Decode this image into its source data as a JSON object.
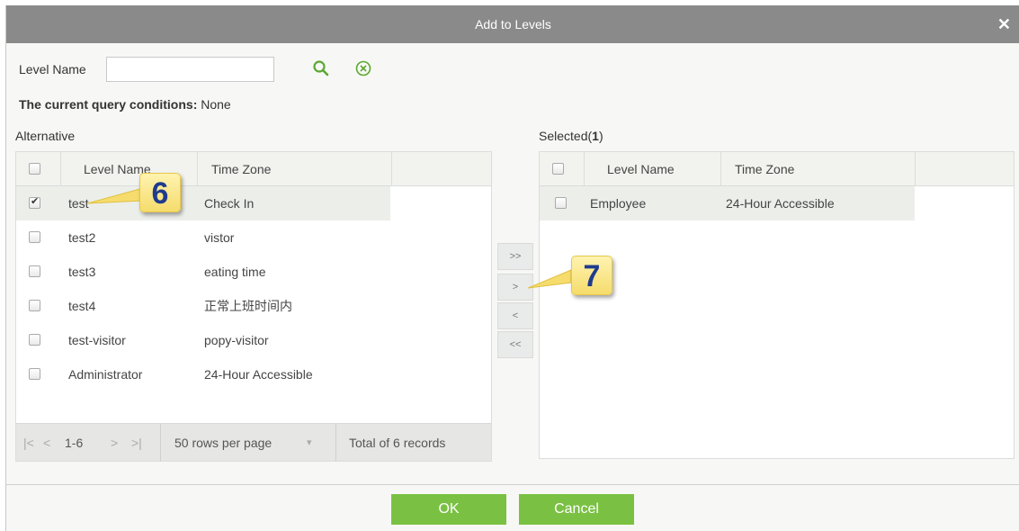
{
  "dialog": {
    "title": "Add to Levels"
  },
  "search": {
    "label": "Level Name",
    "value": "",
    "placeholder": "",
    "conditions_label": "The current query conditions:",
    "conditions_value": "None"
  },
  "alternative": {
    "title": "Alternative",
    "columns": [
      "Level Name",
      "Time Zone"
    ],
    "rows": [
      {
        "name": "test",
        "zone": "Check In",
        "checked": true
      },
      {
        "name": "test2",
        "zone": "vistor",
        "checked": false
      },
      {
        "name": "test3",
        "zone": "eating time",
        "checked": false
      },
      {
        "name": "test4",
        "zone": "正常上班时间内",
        "checked": false
      },
      {
        "name": "test-visitor",
        "zone": "popy-visitor",
        "checked": false
      },
      {
        "name": "Administrator",
        "zone": "24-Hour Accessible",
        "checked": false
      }
    ],
    "pager": {
      "first": "|<",
      "prev": "<",
      "range": "1-6",
      "next": ">",
      "last": ">|",
      "rows_per_page": "50 rows per page",
      "dropdown": "▾",
      "total": "Total of 6 records"
    }
  },
  "selected": {
    "title": "Selected(",
    "count": "1",
    "title_end": ")",
    "columns": [
      "Level Name",
      "Time Zone"
    ],
    "rows": [
      {
        "name": "Employee",
        "zone": "24-Hour Accessible",
        "checked": false
      }
    ]
  },
  "transfer": {
    "all_right": ">>",
    "right": ">",
    "left": "<",
    "all_left": "<<"
  },
  "callouts": {
    "first": "6",
    "second": "7"
  },
  "footer": {
    "ok": "OK",
    "cancel": "Cancel"
  },
  "colors": {
    "titlebar": "#8a8a8a",
    "accent_green": "#7ac143",
    "search_icon": "#5aa830"
  }
}
